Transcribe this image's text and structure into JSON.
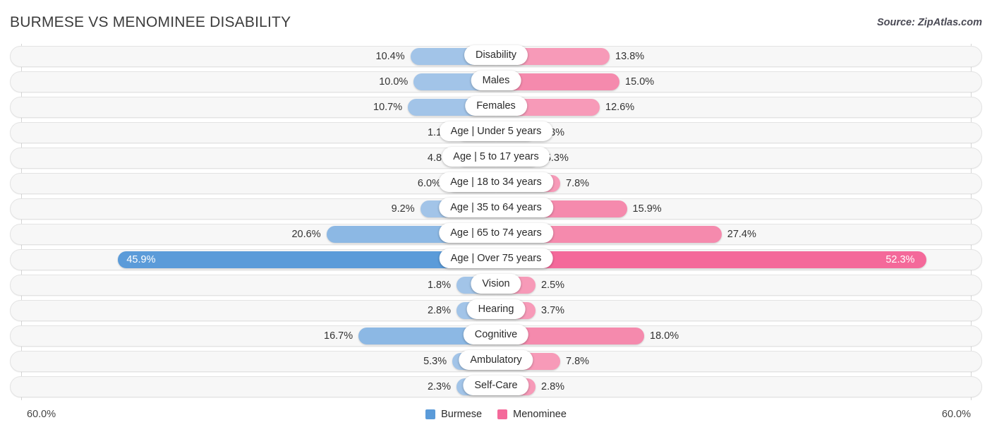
{
  "header": {
    "title": "BURMESE VS MENOMINEE DISABILITY",
    "source": "Source: ZipAtlas.com"
  },
  "axis": {
    "left_label": "60.0%",
    "right_label": "60.0%",
    "max": 60.0
  },
  "legend": [
    {
      "label": "Burmese",
      "color": "#5b9bd9"
    },
    {
      "label": "Menominee",
      "color": "#f4699a"
    }
  ],
  "colors": {
    "blue_light": "#a2c4e8",
    "blue_mid": "#8cb8e4",
    "blue_strong": "#5b9bd9",
    "pink_light": "#f79ab8",
    "pink_mid": "#f58aad",
    "pink_strong": "#f4699a",
    "track_bg": "#f7f7f7",
    "track_border": "#e3e3e3",
    "gridline": "#d6d6d6"
  },
  "chart_data": {
    "type": "bar",
    "title": "BURMESE VS MENOMINEE DISABILITY",
    "orientation": "horizontal-diverging",
    "xlabel": "",
    "ylabel": "",
    "xlim": [
      60.0,
      60.0
    ],
    "grid": true,
    "legend_position": "bottom-center",
    "categories": [
      "Disability",
      "Males",
      "Females",
      "Age | Under 5 years",
      "Age | 5 to 17 years",
      "Age | 18 to 34 years",
      "Age | 35 to 64 years",
      "Age | 65 to 74 years",
      "Age | Over 75 years",
      "Vision",
      "Hearing",
      "Cognitive",
      "Ambulatory",
      "Self-Care"
    ],
    "series": [
      {
        "name": "Burmese",
        "values": [
          10.4,
          10.0,
          10.7,
          1.1,
          4.8,
          6.0,
          9.2,
          20.6,
          45.9,
          1.8,
          2.8,
          16.7,
          5.3,
          2.3
        ],
        "labels": [
          "10.4%",
          "10.0%",
          "10.7%",
          "1.1%",
          "4.8%",
          "6.0%",
          "9.2%",
          "20.6%",
          "45.9%",
          "1.8%",
          "2.8%",
          "16.7%",
          "5.3%",
          "2.3%"
        ]
      },
      {
        "name": "Menominee",
        "values": [
          13.8,
          15.0,
          12.6,
          2.3,
          5.3,
          7.8,
          15.9,
          27.4,
          52.3,
          2.5,
          3.7,
          18.0,
          7.8,
          2.8
        ],
        "labels": [
          "13.8%",
          "15.0%",
          "12.6%",
          "2.3%",
          "5.3%",
          "7.8%",
          "15.9%",
          "27.4%",
          "52.3%",
          "2.5%",
          "3.7%",
          "18.0%",
          "7.8%",
          "2.8%"
        ]
      }
    ]
  }
}
